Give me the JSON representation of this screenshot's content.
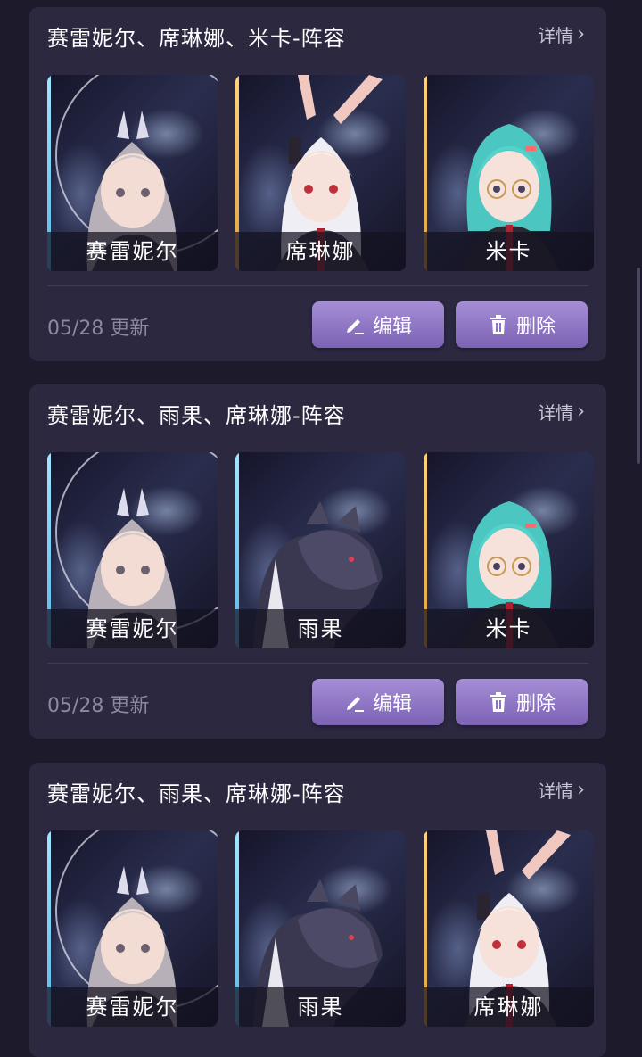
{
  "teams": [
    {
      "title": "赛雷妮尔、席琳娜、米卡-阵容",
      "details_label": "详情",
      "members": [
        {
          "name": "赛雷妮尔",
          "edge": "cyan",
          "art": "silver-hair"
        },
        {
          "name": "席琳娜",
          "edge": "gold",
          "art": "white-hair"
        },
        {
          "name": "米卡",
          "edge": "gold",
          "art": "teal-hair"
        }
      ],
      "date": "05/28 更新",
      "edit_label": "编辑",
      "delete_label": "删除"
    },
    {
      "title": "赛雷妮尔、雨果、席琳娜-阵容",
      "details_label": "详情",
      "members": [
        {
          "name": "赛雷妮尔",
          "edge": "cyan",
          "art": "silver-hair"
        },
        {
          "name": "雨果",
          "edge": "cyan",
          "art": "wolf"
        },
        {
          "name": "米卡",
          "edge": "gold",
          "art": "teal-hair"
        }
      ],
      "date": "05/28 更新",
      "edit_label": "编辑",
      "delete_label": "删除"
    },
    {
      "title": "赛雷妮尔、雨果、席琳娜-阵容",
      "details_label": "详情",
      "members": [
        {
          "name": "赛雷妮尔",
          "edge": "cyan",
          "art": "silver-hair"
        },
        {
          "name": "雨果",
          "edge": "cyan",
          "art": "wolf"
        },
        {
          "name": "席琳娜",
          "edge": "gold",
          "art": "white-hair"
        }
      ]
    }
  ],
  "colors": {
    "background": "#1d1a2c",
    "card": "#2b2840",
    "button": "#8d72c4"
  },
  "icons": {
    "details": "chevron-right-icon",
    "edit": "pencil-icon",
    "delete": "trash-icon"
  }
}
